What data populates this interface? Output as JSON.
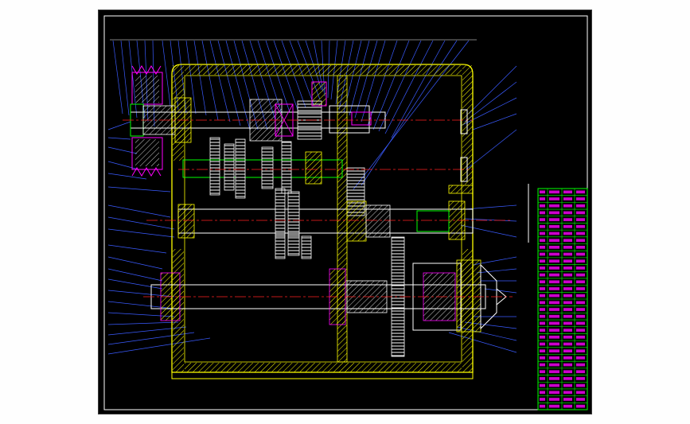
{
  "drawing": {
    "background": "#000000",
    "frame_color": "#ffffff",
    "outline_color": "#ffff00",
    "centerline_color": "#ff2020",
    "leader_color": "#3a5bff",
    "gear_color": "#ffffff",
    "hatch_color": "#ffff00",
    "shaft_color": "#00ff00",
    "bearing_color": "#ff00ff",
    "title_block_color": "#00ff00",
    "title_block_text_color": "#ff00ff"
  },
  "title_block": {
    "rows": 32,
    "columns": 4
  }
}
